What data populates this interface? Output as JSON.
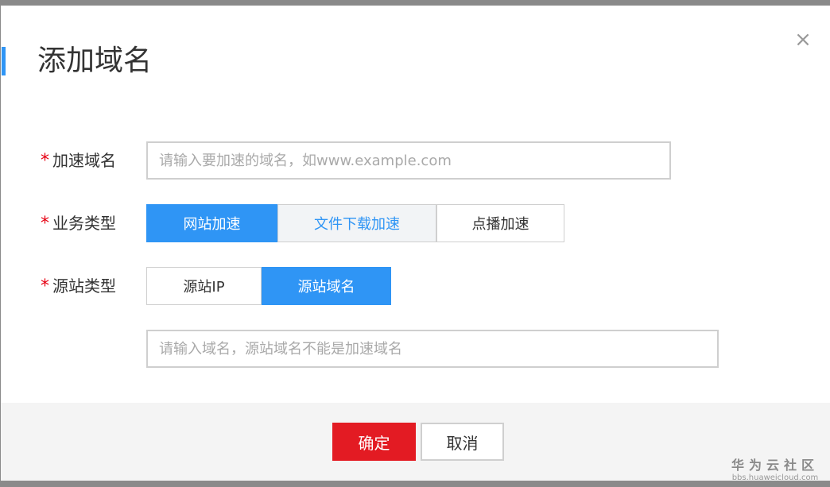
{
  "dialog": {
    "title": "添加域名",
    "close_glyph": "×"
  },
  "form": {
    "required_mark": "*",
    "accel_domain": {
      "label": "加速域名",
      "placeholder": "请输入要加速的域名，如www.example.com",
      "value": ""
    },
    "business_type": {
      "label": "业务类型",
      "options": [
        "网站加速",
        "文件下载加速",
        "点播加速"
      ],
      "selected": "网站加速"
    },
    "origin_type": {
      "label": "源站类型",
      "options": [
        "源站IP",
        "源站域名"
      ],
      "selected": "源站域名"
    },
    "origin_domain": {
      "placeholder": "请输入域名，源站域名不能是加速域名",
      "value": ""
    }
  },
  "footer": {
    "confirm_label": "确定",
    "cancel_label": "取消"
  },
  "watermark": {
    "main": "华为云社区",
    "sub": "bbs.huaweicloud.com"
  },
  "colors": {
    "accent": "#2f95f5",
    "primary_button": "#e31b23",
    "required": "#e60012"
  }
}
